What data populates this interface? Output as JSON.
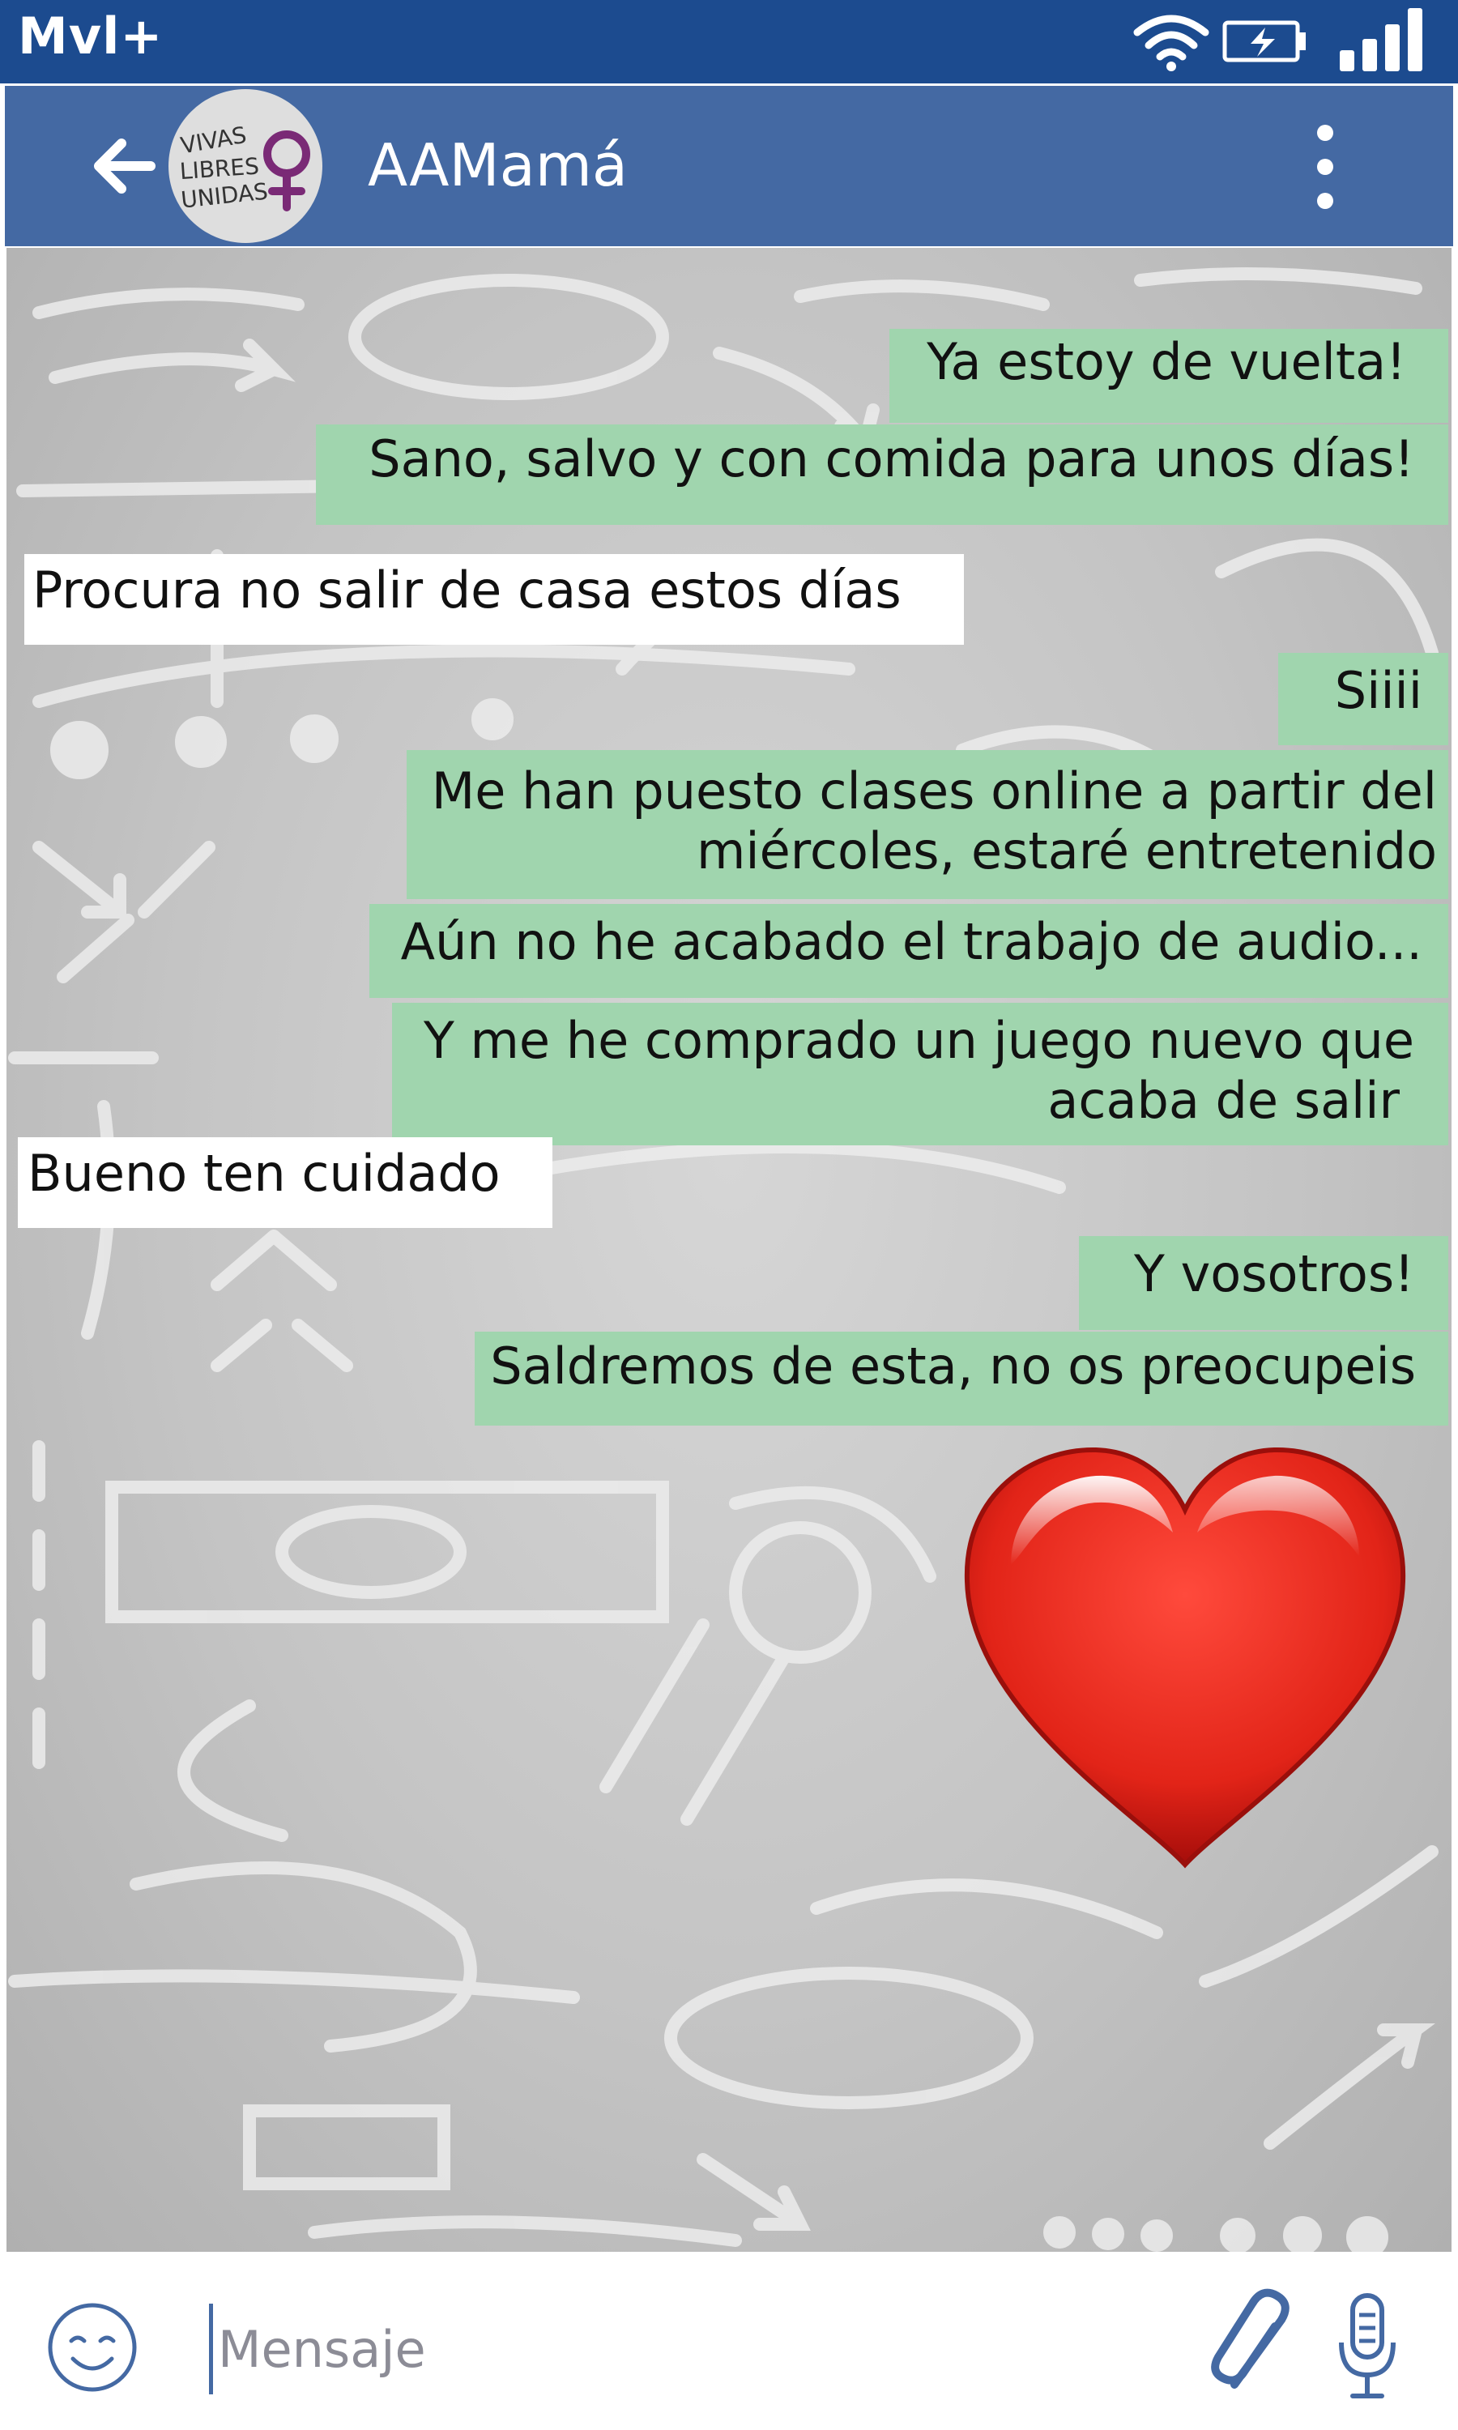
{
  "status_bar": {
    "carrier": "Mvl+",
    "icons": [
      "wifi-icon",
      "battery-charging-icon",
      "signal-icon"
    ]
  },
  "header": {
    "title": "AAMamá",
    "avatar_text": [
      "VIVAS",
      "LIBRES",
      "UNIDAS"
    ],
    "icons": [
      "back-arrow-icon",
      "more-vert-icon"
    ]
  },
  "messages": [
    {
      "direction": "out",
      "lines": [
        "Ya estoy de vuelta!"
      ]
    },
    {
      "direction": "out",
      "lines": [
        "Sano, salvo y con comida para unos días!"
      ]
    },
    {
      "direction": "in",
      "lines": [
        "Procura no salir de casa estos días"
      ]
    },
    {
      "direction": "out",
      "lines": [
        "Siiii"
      ]
    },
    {
      "direction": "out",
      "lines": [
        "Me han puesto clases online a partir del",
        "miércoles, estaré entretenido"
      ]
    },
    {
      "direction": "out",
      "lines": [
        "Aún no he acabado el trabajo de audio..."
      ]
    },
    {
      "direction": "out",
      "lines": [
        "Y me he comprado un juego nuevo que",
        "acaba de salir"
      ]
    },
    {
      "direction": "in",
      "lines": [
        "Bueno ten cuidado"
      ]
    },
    {
      "direction": "out",
      "lines": [
        "Y vosotros!"
      ]
    },
    {
      "direction": "out",
      "lines": [
        "Saldremos de esta, no os preocupeis"
      ]
    }
  ],
  "sticker": {
    "icon": "heart-emoji-icon"
  },
  "input_bar": {
    "placeholder": "Mensaje",
    "icons": [
      "emoji-icon",
      "attach-icon",
      "microphone-icon"
    ]
  },
  "colors": {
    "status_bar": "#1c4b8f",
    "app_bar": "#4469a3",
    "outgoing_bubble": "#a0d5ae",
    "incoming_bubble": "#ffffff",
    "chat_background": "#c4c4c4",
    "heart": "#e0221a"
  }
}
